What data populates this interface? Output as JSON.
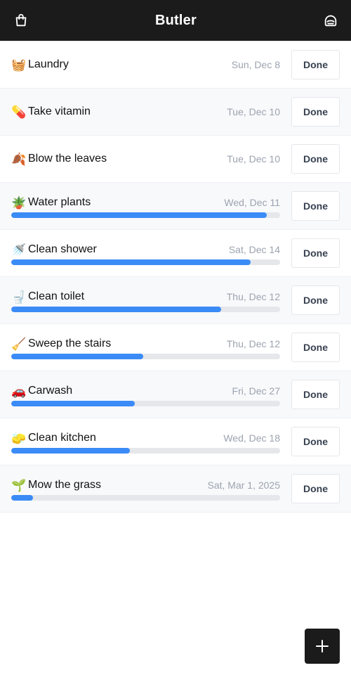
{
  "header": {
    "title": "Butler",
    "left_icon": "shopping-bag-icon",
    "right_icon": "robot-face-icon"
  },
  "done_label": "Done",
  "colors": {
    "header_bg": "#1b1b1b",
    "progress_fill": "#3b8bf6",
    "progress_track": "#e5e7eb",
    "date_text": "#9ca3af"
  },
  "tasks": [
    {
      "emoji": "🧺",
      "name": "Laundry",
      "date": "Sun, Dec 8",
      "progress": null
    },
    {
      "emoji": "💊",
      "name": "Take vitamin",
      "date": "Tue, Dec 10",
      "progress": null
    },
    {
      "emoji": "🍂",
      "name": "Blow the leaves",
      "date": "Tue, Dec 10",
      "progress": null
    },
    {
      "emoji": "🪴",
      "name": "Water plants",
      "date": "Wed, Dec 11",
      "progress": 0.95
    },
    {
      "emoji": "🚿",
      "name": "Clean shower",
      "date": "Sat, Dec 14",
      "progress": 0.89
    },
    {
      "emoji": "🚽",
      "name": "Clean toilet",
      "date": "Thu, Dec 12",
      "progress": 0.78
    },
    {
      "emoji": "🧹",
      "name": "Sweep the stairs",
      "date": "Thu, Dec 12",
      "progress": 0.49
    },
    {
      "emoji": "🚗",
      "name": "Carwash",
      "date": "Fri, Dec 27",
      "progress": 0.46
    },
    {
      "emoji": "🧽",
      "name": "Clean kitchen",
      "date": "Wed, Dec 18",
      "progress": 0.44
    },
    {
      "emoji": "🌱",
      "name": "Mow the grass",
      "date": "Sat, Mar 1, 2025",
      "progress": 0.08
    }
  ],
  "fab_icon": "plus-icon"
}
